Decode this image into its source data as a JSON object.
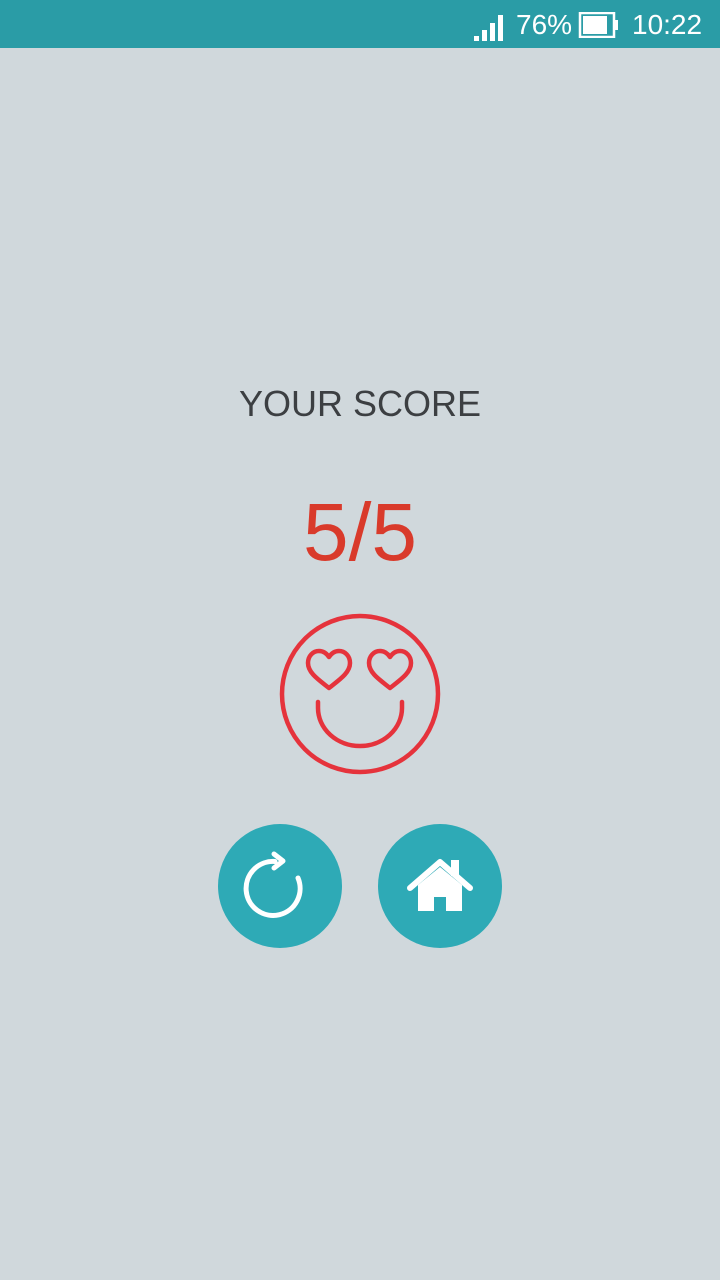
{
  "status_bar": {
    "battery_percent": "76%",
    "time": "10:22",
    "signal_icon": "signal-bars-icon",
    "battery_icon": "battery-icon",
    "background_color": "#2a9ca6"
  },
  "result": {
    "label": "YOUR SCORE",
    "score": "5/5",
    "emoji_icon": "heart-eyes-smiley-icon",
    "score_color": "#d93a2b",
    "emoji_color": "#e5333c"
  },
  "actions": {
    "replay_icon": "replay-icon",
    "home_icon": "home-icon",
    "button_color": "#2eaab6"
  }
}
